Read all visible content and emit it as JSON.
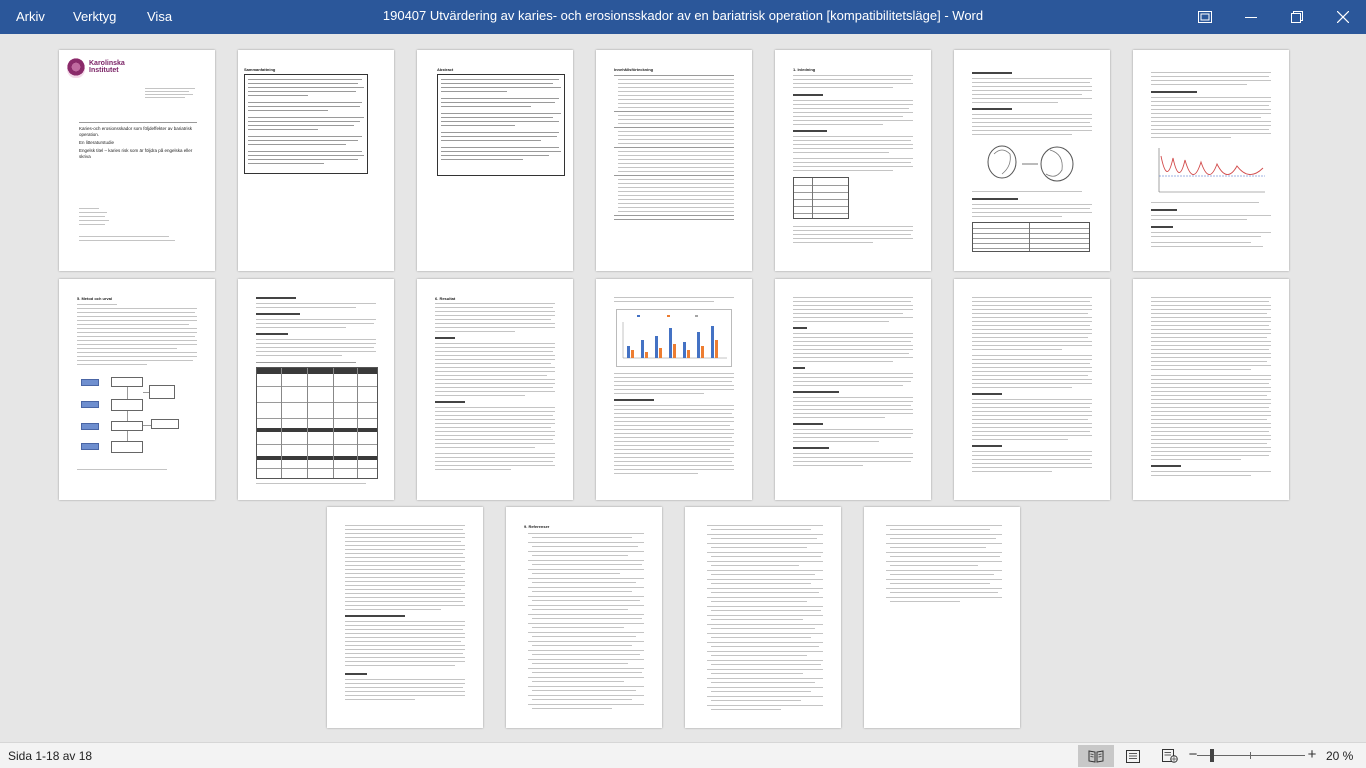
{
  "menu": [
    "Arkiv",
    "Verktyg",
    "Visa"
  ],
  "window_title": "190407 Utvärdering av karies- och erosionsskador av en bariatrisk operation [kompatibilitetsläge]  -  Word",
  "colors": {
    "titlebar": "#2b579a",
    "workspace": "#e6e6e6",
    "statusbar": "#f3f3f3"
  },
  "pages_content": {
    "logo": "Karolinska Institutet",
    "cover_title": "Karies-och erosionsskador som följdeffekter av bariatrisk operation.",
    "cover_subtitle": "En litteraturstudie",
    "cover_english": "Engelsk titel – karies risk som är följdra på engelska eller skriva",
    "abstract_sv": "Sammanfattning",
    "abstract_en": "Abstract",
    "toc": "Innehållsförteckning",
    "intro": "1. Inledning",
    "methods": "5. Metod och urval",
    "results": "6. Resultat",
    "refs": "9. Referenser"
  },
  "status": {
    "page_info": "Sida 1-18 av 18",
    "zoom": "20 %",
    "zoom_minus": "−",
    "zoom_plus": "+"
  },
  "icons": {
    "ribbon_display": "ribbon-display-icon",
    "minimize": "minimize-icon",
    "restore": "restore-icon",
    "close": "close-icon",
    "read_mode": "read-mode-icon",
    "print_layout": "print-layout-icon",
    "web_layout": "web-layout-icon"
  }
}
